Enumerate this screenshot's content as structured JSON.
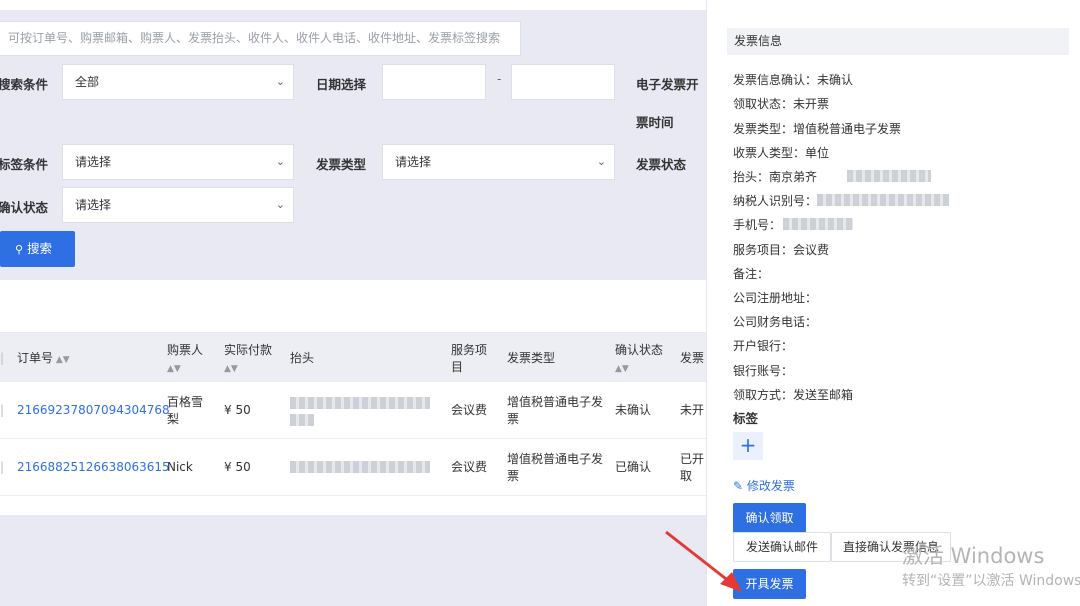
{
  "search": {
    "placeholder": "可按订单号、购票邮箱、购票人、发票抬头、收件人、收件人电话、收件地址、发票标签搜索"
  },
  "filters": {
    "search_condition_label": "搜索条件",
    "search_condition_value": "全部",
    "date_label": "日期选择",
    "date_separator": "-",
    "e_invoice_label_1": "电子发票开",
    "e_invoice_label_2": "票时间",
    "tag_condition_label": "标签条件",
    "tag_condition_value": "请选择",
    "invoice_type_label": "发票类型",
    "invoice_type_value": "请选择",
    "invoice_status_label": "发票状态",
    "confirm_status_label": "确认状态",
    "confirm_status_value": "请选择",
    "search_button": "搜索"
  },
  "table": {
    "headers": {
      "order_no": "订单号",
      "buyer": "购票人",
      "paid": "实际付款",
      "title": "抬头",
      "service_1": "服务项",
      "service_2": "目",
      "invoice_type": "发票类型",
      "confirm_status": "确认状态",
      "invoice_status": "发票"
    },
    "rows": [
      {
        "order_no": "21669237807094304768",
        "buyer_1": "百格雪",
        "buyer_2": "梨",
        "paid": "¥ 50",
        "service": "会议费",
        "invoice_type_1": "增值税普通电子发",
        "invoice_type_2": "票",
        "confirm_status": "未确认",
        "invoice_status_1": "未开",
        "invoice_status_2": ""
      },
      {
        "order_no": "21668825126638063615",
        "buyer_1": "Nick",
        "buyer_2": "",
        "paid": "¥ 50",
        "service": "会议费",
        "invoice_type_1": "增值税普通电子发",
        "invoice_type_2": "票",
        "confirm_status": "已确认",
        "invoice_status_1": "已开",
        "invoice_status_2": "取"
      }
    ]
  },
  "panel": {
    "header": "发票信息",
    "info_confirm": "发票信息确认：未确认",
    "receive_status": "领取状态：未开票",
    "invoice_type": "发票类型：增值税普通电子发票",
    "recipient_type": "收票人类型：单位",
    "title_label": "抬头：南京弟齐",
    "taxpayer_label": "纳税人识别号：",
    "phone_label": "手机号：",
    "service_item": "服务项目：会议费",
    "remark": "备注：",
    "company_address": "公司注册地址：",
    "company_phone": "公司财务电话：",
    "bank": "开户银行：",
    "bank_account": "银行账号：",
    "receive_method": "领取方式：发送至邮箱",
    "tags_label": "标签",
    "add_tag": "+",
    "edit_invoice": "修改发票",
    "confirm_receive": "确认领取",
    "send_email": "发送确认邮件",
    "direct_confirm": "直接确认发票信息",
    "issue_invoice": "开具发票"
  },
  "watermark": {
    "line1": "激活 Windows",
    "line2": "转到“设置”以激活 Windows。"
  },
  "colors": {
    "primary": "#2f6fe4",
    "annotation_arrow": "#e53935"
  }
}
